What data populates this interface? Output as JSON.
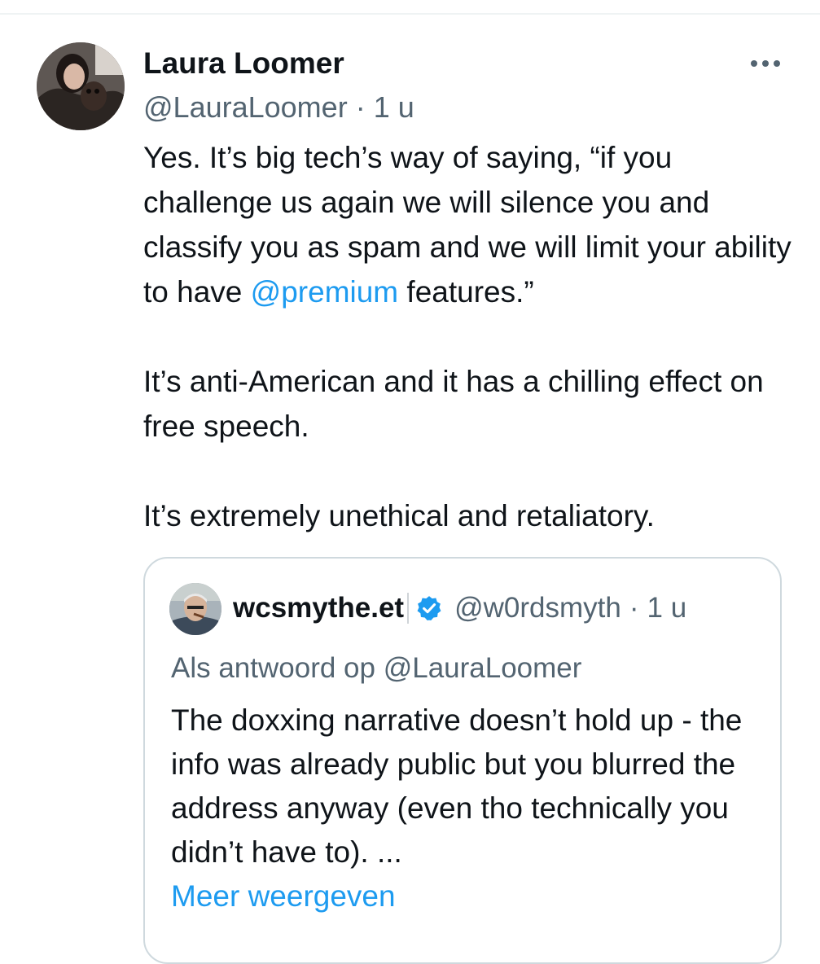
{
  "tweet": {
    "author": {
      "name": "Laura Loomer",
      "handle": "@LauraLoomer",
      "separator": "·",
      "time": "1 u",
      "avatar_icon": "profile-photo"
    },
    "more_icon": "more-dots-icon",
    "body": {
      "para1_before": "Yes. It’s big tech’s way of saying, “if you challenge us again we will silence you and classify you as spam and we will limit your ability to have ",
      "para1_mention": "@premium",
      "para1_after": " features.”",
      "para2": "It’s anti-American and it has a chilling effect on free speech.",
      "para3": "It’s extremely unethical and retaliatory."
    },
    "quote": {
      "name": "wcsmythe.et",
      "verified_icon": "verified-badge-icon",
      "handle": "@w0rdsmyth",
      "separator": "·",
      "time": "1 u",
      "reply_to": "Als antwoord op @LauraLoomer",
      "text": "The doxxing narrative doesn’t hold up - the info was already public but you blurred the address anyway (even tho technically you didn’t have to). ...",
      "show_more": "Meer weergeven"
    }
  },
  "colors": {
    "link": "#1d9bf0",
    "secondary_text": "#536471",
    "primary_text": "#0f1419",
    "border": "#cfd9de"
  }
}
